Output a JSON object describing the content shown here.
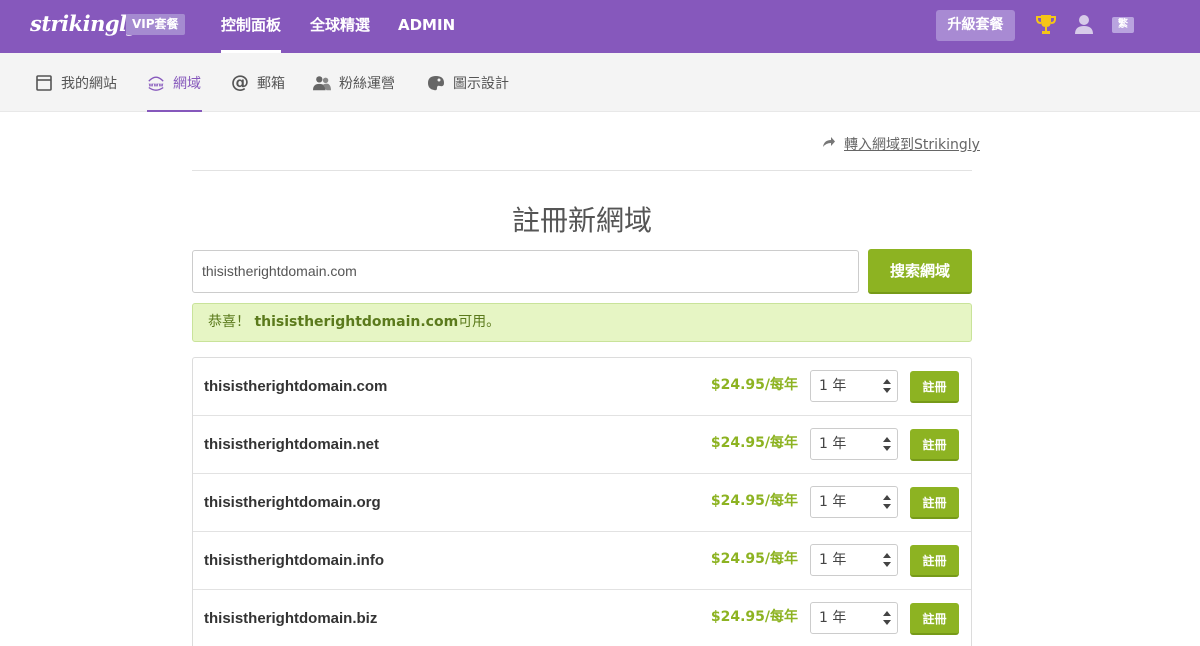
{
  "topbar": {
    "logo": "strikingly",
    "vip_badge": "VIP套餐",
    "nav": [
      "控制面板",
      "全球精選",
      "ADMIN"
    ],
    "upgrade_label": "升級套餐",
    "lang_label": "繁"
  },
  "subnav": {
    "items": [
      {
        "label": "我的網站",
        "icon": "browser-window-icon"
      },
      {
        "label": "網域",
        "icon": "www-globe-icon"
      },
      {
        "label": "郵箱",
        "icon": "at-sign-icon"
      },
      {
        "label": "粉絲運營",
        "icon": "users-icon"
      },
      {
        "label": "圖示設計",
        "icon": "palette-icon"
      }
    ],
    "active_index": 1
  },
  "main": {
    "transfer_link": "轉入網域到Strikingly",
    "title": "註冊新網域",
    "search_value": "thisistherightdomain.com",
    "search_button": "搜索網域",
    "alert_prefix": "恭喜！",
    "alert_domain": "thisistherightdomain.com",
    "alert_suffix": "可用。"
  },
  "results": [
    {
      "domain": "thisistherightdomain.com",
      "price": "$24.95/每年",
      "term": "1 年",
      "action": "註冊"
    },
    {
      "domain": "thisistherightdomain.net",
      "price": "$24.95/每年",
      "term": "1 年",
      "action": "註冊"
    },
    {
      "domain": "thisistherightdomain.org",
      "price": "$24.95/每年",
      "term": "1 年",
      "action": "註冊"
    },
    {
      "domain": "thisistherightdomain.info",
      "price": "$24.95/每年",
      "term": "1 年",
      "action": "註冊"
    },
    {
      "domain": "thisistherightdomain.biz",
      "price": "$24.95/每年",
      "term": "1 年",
      "action": "註冊"
    }
  ],
  "colors": {
    "brand_purple": "#8658bc",
    "accent_green": "#8db322",
    "alert_bg": "#e6f5c4"
  }
}
